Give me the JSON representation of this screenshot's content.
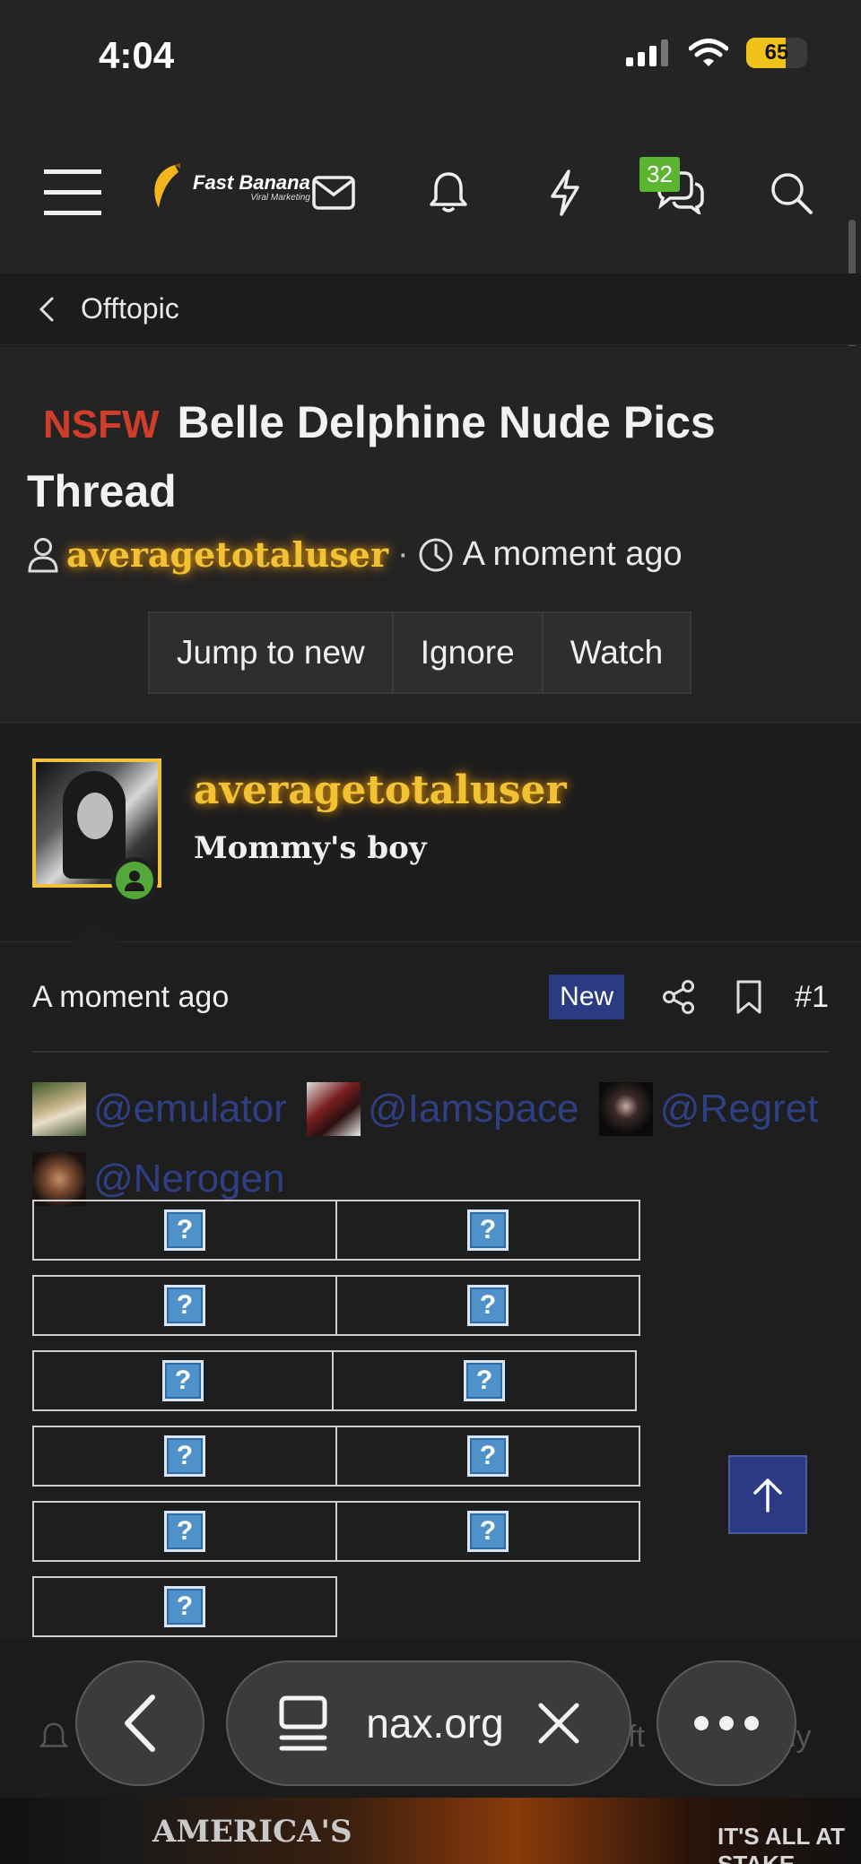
{
  "status_bar": {
    "time": "4:04",
    "battery": "65",
    "battery_level": 0.65
  },
  "header": {
    "brand": "Fast Banana",
    "brand_tagline": "Viral Marketing",
    "conversations_badge": "32"
  },
  "breadcrumb": {
    "label": "Offtopic"
  },
  "thread": {
    "prefix": "NSFW",
    "title": "Belle Delphine Nude Pics Thread",
    "author": "averagetotaluser",
    "separator": "·",
    "time": "A moment ago",
    "buttons": [
      "Jump to new",
      "Ignore",
      "Watch"
    ]
  },
  "post": {
    "author": "averagetotaluser",
    "user_title": "Mommy's boy",
    "time": "A moment ago",
    "new_badge": "New",
    "number": "#1",
    "mentions": [
      "@emulator",
      "@Iamspace",
      "@Regret",
      "@Nerogen"
    ],
    "broken_image_glyph": "?"
  },
  "browser": {
    "url": "nax.org"
  },
  "footer": {
    "reply_fragment": "ly",
    "partial_fragment": "ft"
  },
  "ad": {
    "headline": "AMERICA'S",
    "tagline": "IT'S ALL AT STAKE"
  },
  "colors": {
    "accent_gold": "#f2c135",
    "nsfw_red": "#d13d2b",
    "link_blue": "#2f3f84",
    "badge_green": "#5cb531",
    "new_badge": "#2a3b83"
  }
}
